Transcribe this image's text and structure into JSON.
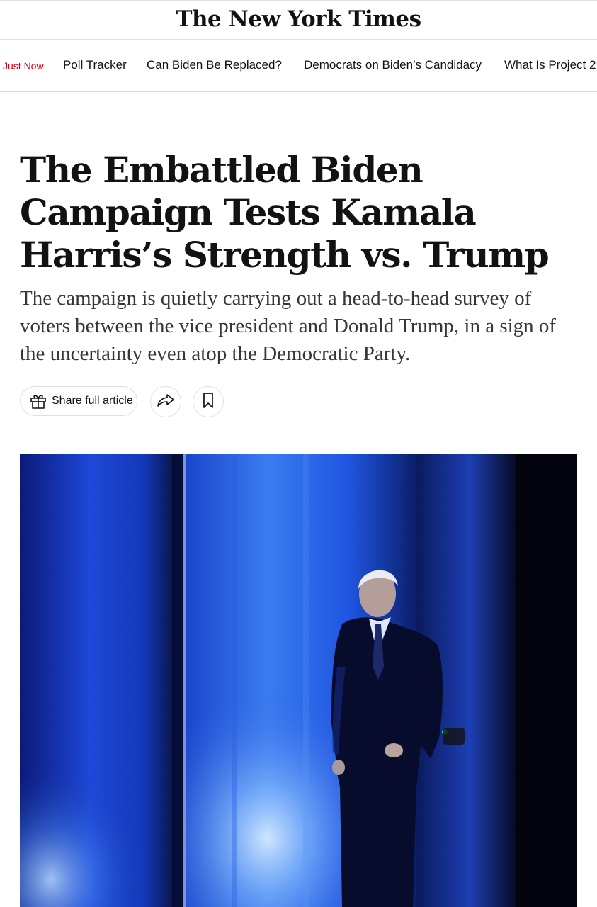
{
  "masthead": {
    "logo_text": "The New York Times"
  },
  "nav": {
    "items": [
      {
        "label": "Just Now"
      },
      {
        "label": "Poll Tracker"
      },
      {
        "label": "Can Biden Be Replaced?"
      },
      {
        "label": "Democrats on Biden’s Candidacy"
      },
      {
        "label": "What Is Project 2"
      }
    ]
  },
  "article": {
    "headline": "The Embattled Biden Campaign Tests Kamala Harris’s Strength vs. Trump",
    "summary": "The campaign is quietly carrying out a head-to-head survey of voters between the vice president and Donald Trump, in a sign of the uncertainty even atop the Democratic Party."
  },
  "actions": {
    "share_label": "Share full article",
    "gift_icon": "gift-icon",
    "forward_icon": "share-arrow-icon",
    "bookmark_icon": "bookmark-icon"
  },
  "colors": {
    "live_red": "#d0021b",
    "text": "#121212",
    "summary_text": "#363636",
    "border": "#dfdfdf"
  }
}
